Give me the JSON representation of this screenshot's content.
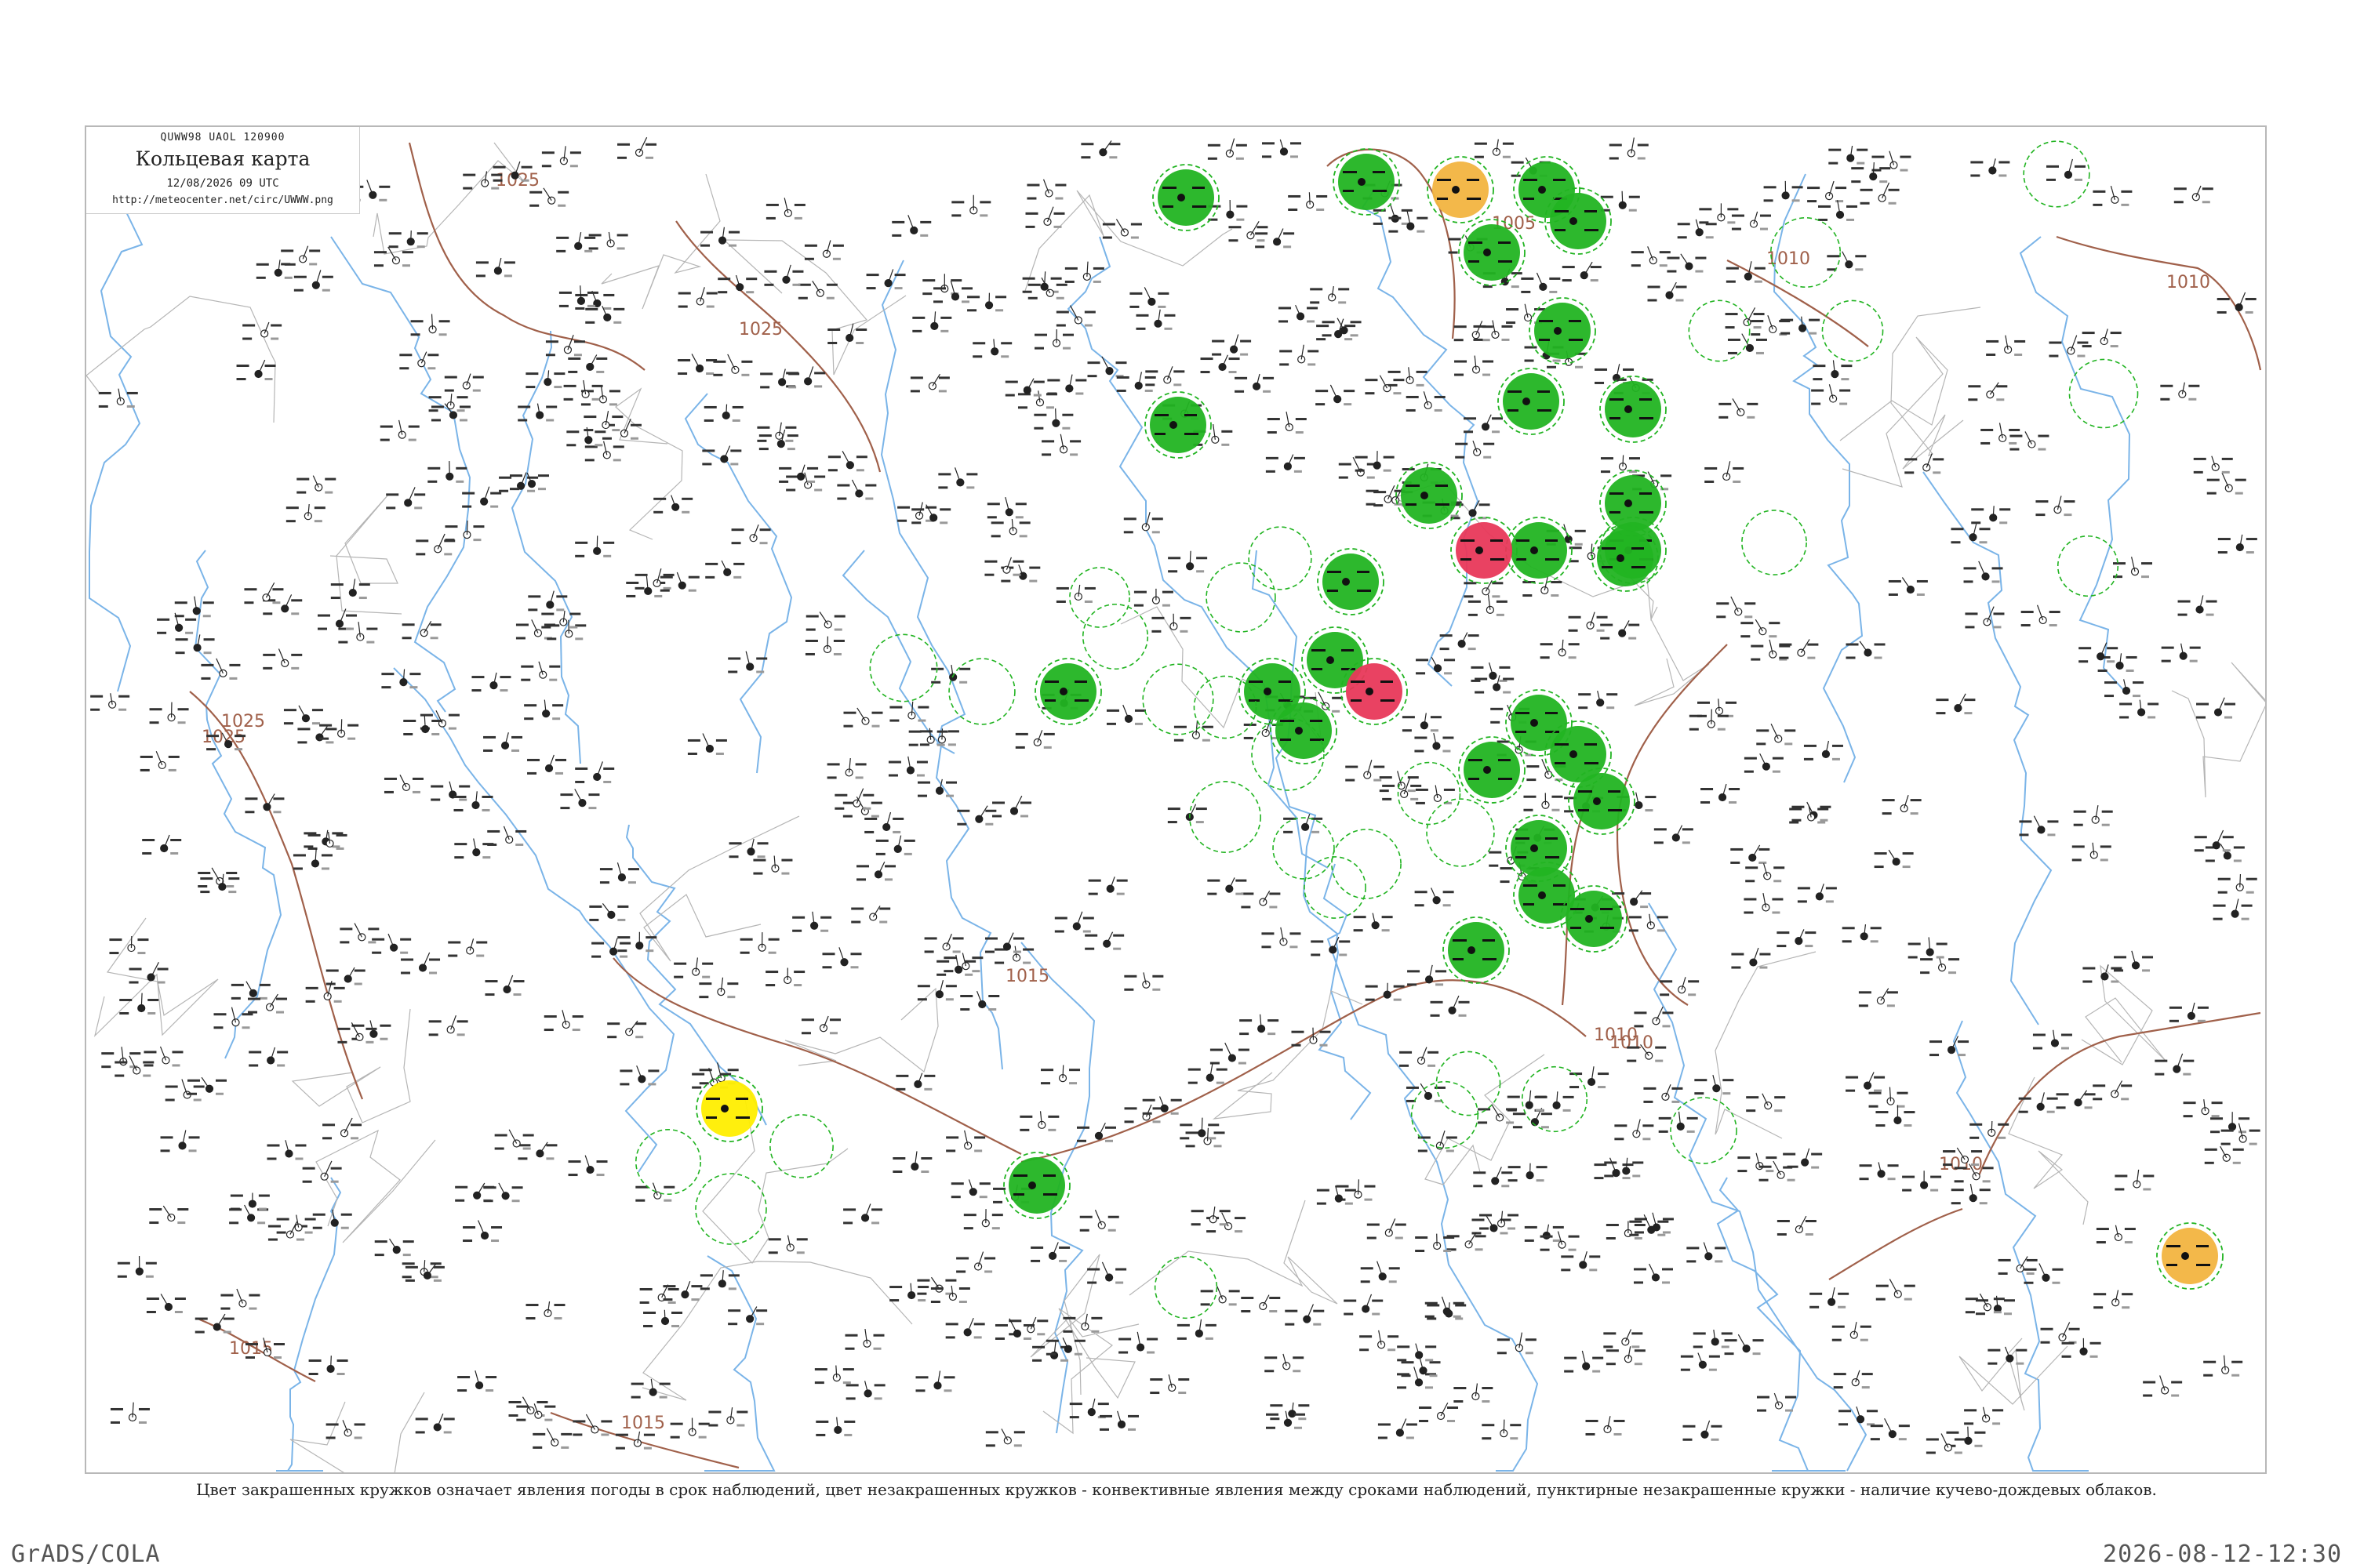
{
  "header": {
    "code": "QUWW98  UAOL  120900",
    "title": "Кольцевая карта",
    "datetime": "12/08/2026 09 UTC",
    "url": "http://meteocenter.net/circ/UWWW.png"
  },
  "legend_caption": "Цвет закрашенных кружков означает явления погоды в срок наблюдений, цвет незакрашенных кружков - конвективные явления между сроками наблюдений, пунктирные незакрашенные кружки - наличие кучево-дождевых облаков.",
  "footer": {
    "left": "GrADS/COLA",
    "right": "2026-08-12-12:30"
  },
  "colors": {
    "river": "#7ab4e8",
    "isobar": "#a0604a",
    "isobar_label": "#a0604a",
    "road": "#b5b5b5",
    "rain": "#22b422",
    "thunder": "#e8385a",
    "haze": "#ffee00",
    "fog": "#f2b440",
    "cb_ring": "#22b422"
  },
  "isobars": [
    {
      "label": "1025"
    },
    {
      "label": "1025"
    },
    {
      "label": "1025"
    },
    {
      "label": "1025"
    },
    {
      "label": "1015"
    },
    {
      "label": "1015"
    },
    {
      "label": "1015"
    },
    {
      "label": "1010"
    },
    {
      "label": "1010"
    },
    {
      "label": "1010"
    },
    {
      "label": "1010"
    },
    {
      "label": "1010"
    },
    {
      "label": "1005"
    }
  ],
  "weather_circles": [
    {
      "type": "rain"
    },
    {
      "type": "rain"
    },
    {
      "type": "rain"
    },
    {
      "type": "rain"
    },
    {
      "type": "rain"
    },
    {
      "type": "rain"
    },
    {
      "type": "rain"
    },
    {
      "type": "rain"
    },
    {
      "type": "rain"
    },
    {
      "type": "rain"
    },
    {
      "type": "rain"
    },
    {
      "type": "rain"
    },
    {
      "type": "rain"
    },
    {
      "type": "rain"
    },
    {
      "type": "rain"
    },
    {
      "type": "rain"
    },
    {
      "type": "rain"
    },
    {
      "type": "rain"
    },
    {
      "type": "rain"
    },
    {
      "type": "rain"
    },
    {
      "type": "rain"
    },
    {
      "type": "rain"
    },
    {
      "type": "rain"
    },
    {
      "type": "rain"
    },
    {
      "type": "rain"
    },
    {
      "type": "rain"
    },
    {
      "type": "rain"
    },
    {
      "type": "rain"
    },
    {
      "type": "thunder"
    },
    {
      "type": "thunder"
    },
    {
      "type": "haze"
    },
    {
      "type": "fog"
    },
    {
      "type": "fog"
    }
  ]
}
